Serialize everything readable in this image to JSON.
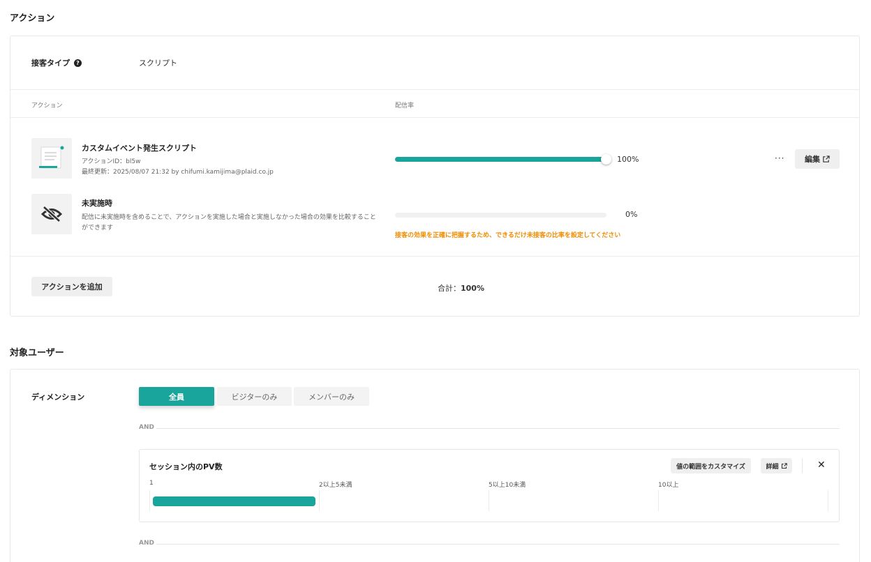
{
  "action_section": {
    "title": "アクション",
    "type_label": "接客タイプ",
    "type_value": "スクリプト",
    "col_action": "アクション",
    "col_rate": "配信率",
    "items": [
      {
        "title": "カスタムイベント発生スクリプト",
        "id_line": "アクションID：bl5w",
        "updated_line": "最終更新：2025/08/07 21:32 by chifumi.kamijima@plaid.co.jp",
        "rate": 100,
        "rate_label": "100%",
        "icon": "script-document-icon"
      },
      {
        "title": "未実施時",
        "desc_line1": "配信に未実施時を含めることで、アクションを実施した場合と実施しなかった場合の効果を比較すること",
        "desc_line2": "ができます",
        "rate": 0,
        "rate_label": "0%",
        "warning": "接客の効果を正確に把握するため、できるだけ未接客の比率を設定してください",
        "icon": "eye-off-icon"
      }
    ],
    "more_label": "···",
    "edit_label": "編集",
    "add_label": "アクションを追加",
    "total_label": "合計：",
    "total_value": "100%"
  },
  "audience_section": {
    "title": "対象ユーザー",
    "dimension_label": "ディメンション",
    "segments": [
      "全員",
      "ビジターのみ",
      "メンバーのみ"
    ],
    "selected_segment": "全員",
    "and_label": "AND",
    "condition": {
      "title": "セッション内のPV数",
      "customize_label": "値の範囲をカスタマイズ",
      "detail_label": "詳細",
      "ticks": [
        "1",
        "2以上5未満",
        "5以上10未満",
        "10以上"
      ],
      "selected_range": "1"
    }
  },
  "colors": {
    "accent": "#19a59b",
    "warning": "#f08c00"
  }
}
